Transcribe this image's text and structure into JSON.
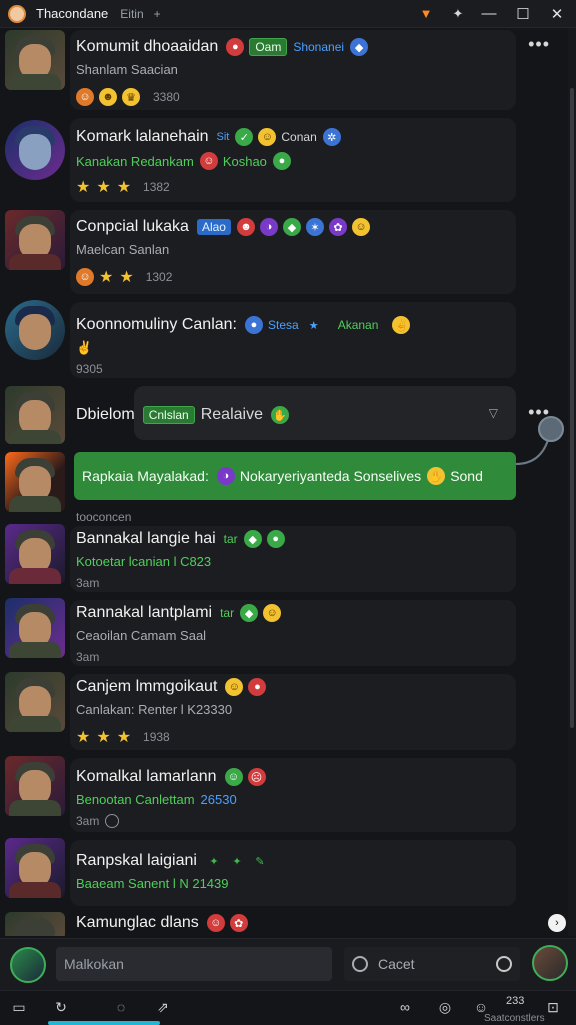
{
  "window": {
    "title": "Thacondane",
    "tab": "Eitin",
    "tab_icon": "+"
  },
  "rows": [
    {
      "name": "Komumit dhoaaidan",
      "badge1": "Oam",
      "badge2": "Shonanei",
      "sub": "Shanlam Saacian",
      "meta": "3380"
    },
    {
      "name": "Komark lalanehain",
      "badge1": "Sit",
      "badge2": "Conan",
      "sub": "Kanakan Redankam",
      "sub2": "Koshao",
      "meta": "1382"
    },
    {
      "name": "Conpcial lukaka",
      "badge1": "Alao",
      "sub": "Maelcan Sanlan",
      "meta": "1302"
    },
    {
      "name": "Koonnomuliny Canlan:",
      "badge1": "Stesa",
      "badge2": "Akanan",
      "sub": "",
      "meta": "9305"
    },
    {
      "name": "Dbielom",
      "badge1": "Cnlslan",
      "badge2": "Realaive"
    },
    {
      "name": "Rapkaia Mayalakad:",
      "badge1": "Nokaryeriyanteda Sonselives",
      "badge2": "Sond",
      "meta": "tooconcen"
    },
    {
      "name": "Bannakal langie hai",
      "badge1": "tar",
      "sub": "Kotoetar lcanian l C823",
      "meta": "3am"
    },
    {
      "name": "Rannakal lantplami",
      "badge1": "tar",
      "sub": "Ceaoilan Camam Saal",
      "meta": "3am"
    },
    {
      "name": "Canjem lmmgoikaut",
      "sub": "Canlakan: Renter l K23330",
      "meta": "1938"
    },
    {
      "name": "Komalkal lamarlann",
      "sub": "Benootan Canlettam",
      "sub2": "26530",
      "meta": "3am"
    },
    {
      "name": "Ranpskal laigiani",
      "sub": "Baaeam Sanent l N 21439"
    },
    {
      "name": "Kamunglac dlans"
    }
  ],
  "composer": {
    "placeholder": "Malkokan",
    "search_placeholder": "Cacet"
  },
  "bottombar": {
    "count": "233",
    "label": "Saatconstlers"
  },
  "colors": {
    "accent_green": "#3aa948",
    "accent_blue": "#2a6bc9",
    "active_tab": "#1fb6d8",
    "background": "#141518"
  }
}
